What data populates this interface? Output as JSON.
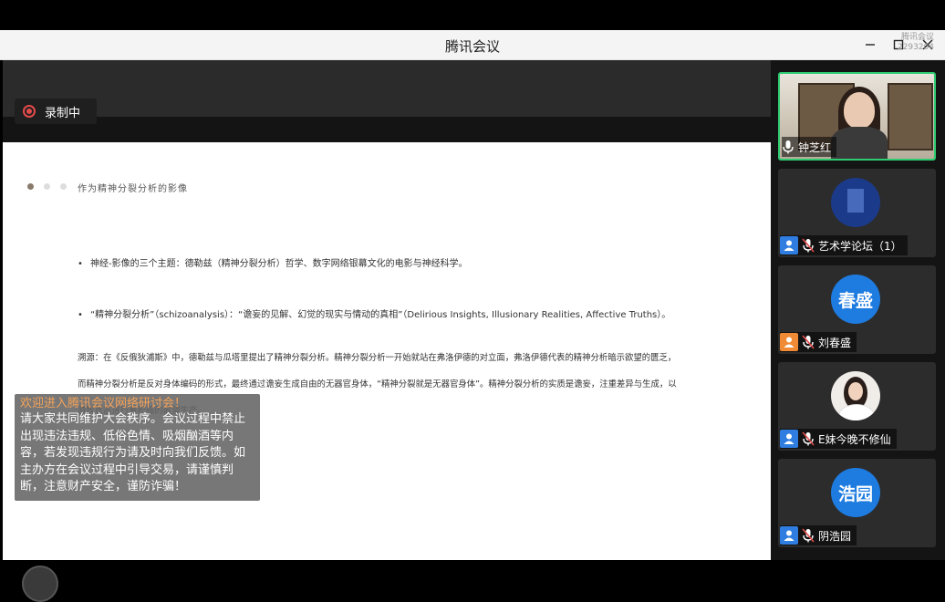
{
  "window": {
    "title": "腾讯会议",
    "overlay_line1": "腾讯会议",
    "overlay_id": "2293204"
  },
  "recording": {
    "label": "录制中"
  },
  "slide": {
    "title": "作为精神分裂分析的影像",
    "bullets": [
      "神经-影像的三个主题：德勒兹（精神分裂分析）哲学、数字网络银幕文化的电影与神经科学。",
      "“精神分裂分析”（schizoanalysis）：“谵妄的见解、幻觉的现实与情动的真相”（Delirious Insights, Illusionary Realities, Affective Truths）。"
    ],
    "paragraph": "溯源：在《反俄狄浦斯》中，德勒兹与瓜塔里提出了精神分裂分析。精神分裂分析一开始就站在弗洛伊德的对立面，弗洛伊德代表的精神分析暗示欲望的匮乏，而精神分裂分析是反对身体编码的形式，最终通过谵妄生成自由的无器官身体，“精神分裂就是无器官身体”。精神分裂分析的实质是谵妄，注重差异与生成，以游牧状态进行着积极的欲望生产。"
  },
  "notice": {
    "title": "欢迎进入腾讯会议网络研讨会！",
    "body": "请大家共同维护大会秩序。会议过程中禁止出现违法违规、低俗色情、吸烟酗酒等内容，若发现违规行为请及时向我们反馈。如主办方在会议过程中引导交易，请谨慎判断，注意财产安全，谨防诈骗！"
  },
  "participants": [
    {
      "name": "钟芝红",
      "type": "video",
      "active": true
    },
    {
      "name": "艺术学论坛（1）",
      "type": "image"
    },
    {
      "name": "刘春盛",
      "type": "text",
      "avatar_text": "春盛",
      "badge_color": "#f08a35"
    },
    {
      "name": "E妹今晚不修仙",
      "type": "photo"
    },
    {
      "name": "阴浩园",
      "type": "text",
      "avatar_text": "浩园",
      "badge_color": "#2f7de1"
    }
  ]
}
